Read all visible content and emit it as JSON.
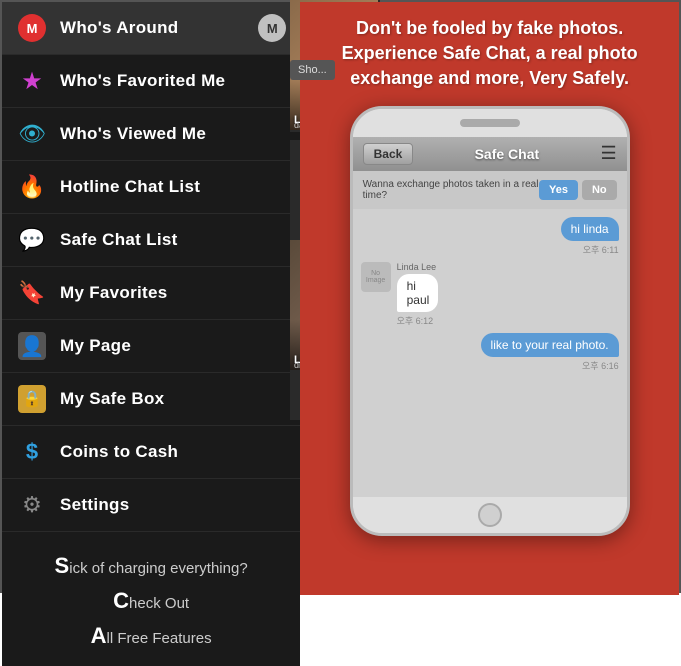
{
  "leftPanel": {
    "menuItems": [
      {
        "id": "whos-around",
        "label": "Who's Around",
        "iconType": "red-circle",
        "iconText": "M"
      },
      {
        "id": "whos-favorited",
        "label": "Who's Favorited Me",
        "iconType": "star"
      },
      {
        "id": "whos-viewed",
        "label": "Who's Viewed Me",
        "iconType": "eye"
      },
      {
        "id": "hotline-chat",
        "label": "Hotline Chat List",
        "iconType": "fire"
      },
      {
        "id": "safe-chat",
        "label": "Safe Chat List",
        "iconType": "chat"
      },
      {
        "id": "my-favorites",
        "label": "My Favorites",
        "iconType": "bookmark"
      },
      {
        "id": "my-page",
        "label": "My Page",
        "iconType": "person"
      },
      {
        "id": "my-safe-box",
        "label": "My Safe Box",
        "iconType": "safe-box"
      },
      {
        "id": "coins-to-cash",
        "label": "Coins to Cash",
        "iconType": "coin"
      },
      {
        "id": "settings",
        "label": "Settings",
        "iconType": "gear"
      }
    ],
    "topButtonLabel": "M",
    "promoLine1": "ick of charging everything?",
    "promoLine2": "heck Out",
    "promoLine3": "ll Free Features"
  },
  "rightPanel": {
    "promoText": "Don't be fooled by fake photos.\nExperience Safe Chat, a real photo\nexchange and more, Very Safely.",
    "phone": {
      "chatHeader": {
        "backLabel": "Back",
        "title": "Safe Chat",
        "listIconLabel": "≡"
      },
      "banner": {
        "text": "Wanna exchange photos taken in a real time?",
        "yesLabel": "Yes",
        "noLabel": "No"
      },
      "messages": [
        {
          "type": "right",
          "text": "hi linda",
          "time": "오후 6:11"
        },
        {
          "type": "left",
          "sender": "Linda Lee",
          "text": "hi paul",
          "time": "오후 6:12"
        },
        {
          "type": "right",
          "text": "like to your real photo.",
          "time": "오후 6:16"
        }
      ]
    },
    "previewCards": [
      {
        "name": "Laura",
        "sub": "danc..."
      },
      {
        "name": "Liz Ja",
        "sub": "drinki..."
      }
    ],
    "showMoreLabel": "Sho..."
  }
}
